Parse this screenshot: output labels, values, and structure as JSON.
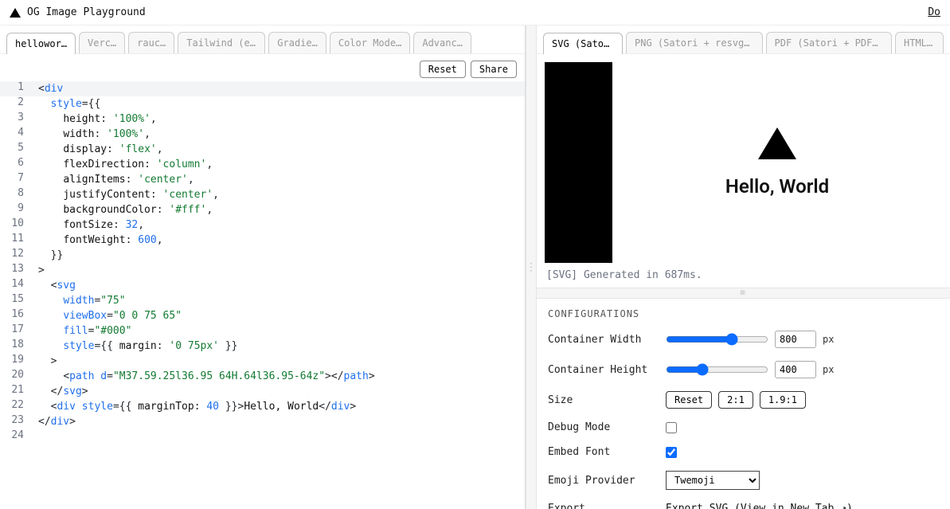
{
  "header": {
    "title": "OG Image Playground",
    "docs": "Do"
  },
  "left": {
    "tabs": [
      "hellowor…",
      "Verc…",
      "rauc…",
      "Tailwind (experiment…",
      "Gradie…",
      "Color Mode…",
      "Advanc…"
    ],
    "activeTab": 0,
    "toolbar": {
      "reset": "Reset",
      "share": "Share"
    },
    "code": [
      {
        "n": 1,
        "hl": true,
        "html": "<span class='tok-p'>&lt;</span><span class='tok-tag'>div</span>"
      },
      {
        "n": 2,
        "html": "  <span class='tok-attr'>style</span><span class='tok-p'>={{</span>"
      },
      {
        "n": 3,
        "html": "    <span class='tok-kw'>height</span><span class='tok-p'>:</span> <span class='tok-str'>'100%'</span><span class='tok-p'>,</span>"
      },
      {
        "n": 4,
        "html": "    <span class='tok-kw'>width</span><span class='tok-p'>:</span> <span class='tok-str'>'100%'</span><span class='tok-p'>,</span>"
      },
      {
        "n": 5,
        "html": "    <span class='tok-kw'>display</span><span class='tok-p'>:</span> <span class='tok-str'>'flex'</span><span class='tok-p'>,</span>"
      },
      {
        "n": 6,
        "html": "    <span class='tok-kw'>flexDirection</span><span class='tok-p'>:</span> <span class='tok-str'>'column'</span><span class='tok-p'>,</span>"
      },
      {
        "n": 7,
        "html": "    <span class='tok-kw'>alignItems</span><span class='tok-p'>:</span> <span class='tok-str'>'center'</span><span class='tok-p'>,</span>"
      },
      {
        "n": 8,
        "html": "    <span class='tok-kw'>justifyContent</span><span class='tok-p'>:</span> <span class='tok-str'>'center'</span><span class='tok-p'>,</span>"
      },
      {
        "n": 9,
        "html": "    <span class='tok-kw'>backgroundColor</span><span class='tok-p'>:</span> <span class='tok-str'>'#fff'</span><span class='tok-p'>,</span>"
      },
      {
        "n": 10,
        "html": "    <span class='tok-kw'>fontSize</span><span class='tok-p'>:</span> <span class='tok-num'>32</span><span class='tok-p'>,</span>"
      },
      {
        "n": 11,
        "html": "    <span class='tok-kw'>fontWeight</span><span class='tok-p'>:</span> <span class='tok-num'>600</span><span class='tok-p'>,</span>"
      },
      {
        "n": 12,
        "html": "  <span class='tok-p'>}}</span>"
      },
      {
        "n": 13,
        "html": "<span class='tok-p'>&gt;</span>"
      },
      {
        "n": 14,
        "html": "  <span class='tok-p'>&lt;</span><span class='tok-tag'>svg</span>"
      },
      {
        "n": 15,
        "html": "    <span class='tok-attr'>width</span><span class='tok-p'>=</span><span class='tok-str'>\"75\"</span>"
      },
      {
        "n": 16,
        "html": "    <span class='tok-attr'>viewBox</span><span class='tok-p'>=</span><span class='tok-str'>\"0 0 75 65\"</span>"
      },
      {
        "n": 17,
        "html": "    <span class='tok-attr'>fill</span><span class='tok-p'>=</span><span class='tok-str'>\"#000\"</span>"
      },
      {
        "n": 18,
        "html": "    <span class='tok-attr'>style</span><span class='tok-p'>={{ </span><span class='tok-kw'>margin</span><span class='tok-p'>:</span> <span class='tok-str'>'0 75px'</span><span class='tok-p'> }}</span>"
      },
      {
        "n": 19,
        "html": "  <span class='tok-p'>&gt;</span>"
      },
      {
        "n": 20,
        "html": "    <span class='tok-p'>&lt;</span><span class='tok-tag'>path</span> <span class='tok-attr'>d</span><span class='tok-p'>=</span><span class='tok-str'>\"M37.59.25l36.95 64H.64l36.95-64z\"</span><span class='tok-p'>&gt;&lt;/</span><span class='tok-tag'>path</span><span class='tok-p'>&gt;</span>"
      },
      {
        "n": 21,
        "html": "  <span class='tok-p'>&lt;/</span><span class='tok-tag'>svg</span><span class='tok-p'>&gt;</span>"
      },
      {
        "n": 22,
        "html": "  <span class='tok-p'>&lt;</span><span class='tok-tag'>div</span> <span class='tok-attr'>style</span><span class='tok-p'>={{ </span><span class='tok-kw'>marginTop</span><span class='tok-p'>:</span> <span class='tok-num'>40</span><span class='tok-p'> }}&gt;</span>Hello, World<span class='tok-p'>&lt;/</span><span class='tok-tag'>div</span><span class='tok-p'>&gt;</span>"
      },
      {
        "n": 23,
        "html": "<span class='tok-p'>&lt;/</span><span class='tok-tag'>div</span><span class='tok-p'>&gt;</span>"
      },
      {
        "n": 24,
        "html": ""
      }
    ]
  },
  "right": {
    "tabs": [
      "SVG (Satori)",
      "PNG (Satori + resvg-js)",
      "PDF (Satori + PDFKit)",
      "HTML ("
    ],
    "activeTab": 0,
    "preview": {
      "text": "Hello, World"
    },
    "status": "[SVG] Generated in 687ms.",
    "configs": {
      "heading": "CONFIGURATIONS",
      "width": {
        "label": "Container Width",
        "value": "800",
        "unit": "px"
      },
      "height": {
        "label": "Container Height",
        "value": "400",
        "unit": "px"
      },
      "size": {
        "label": "Size",
        "reset": "Reset",
        "opt1": "2:1",
        "opt2": "1.9:1"
      },
      "debug": {
        "label": "Debug Mode",
        "checked": false
      },
      "embed": {
        "label": "Embed Font",
        "checked": true
      },
      "emoji": {
        "label": "Emoji Provider",
        "value": "Twemoji"
      },
      "export": {
        "label": "Export",
        "link": "Export SVG",
        "view": "(View in New Tab ↗)"
      }
    }
  }
}
